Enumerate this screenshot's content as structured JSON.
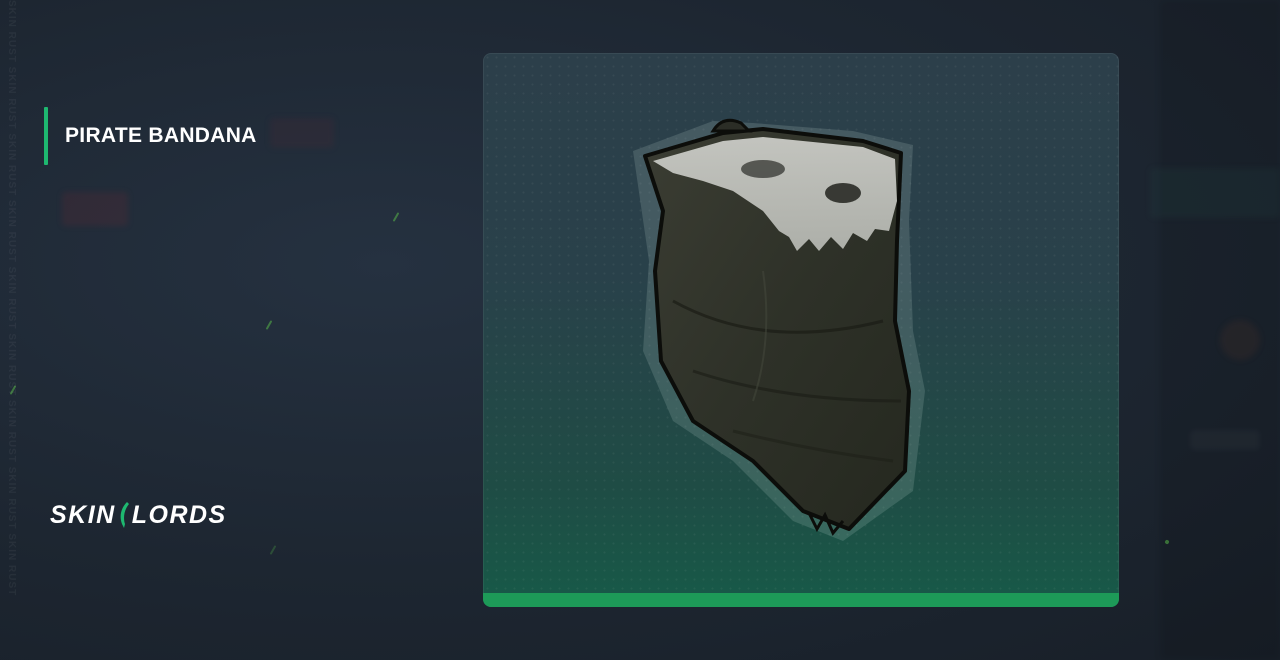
{
  "item": {
    "name": "PIRATE BANDANA",
    "image_icon": "pirate-bandana-icon"
  },
  "brand": {
    "logo_left": "SKIN",
    "logo_right": "LORDS",
    "watermark": "SKIN RUST SKIN RUST SKIN RUST SKIN RUST SKIN RUST SKIN RUST SKIN RUST SKIN RUST SKIN RUST"
  },
  "colors": {
    "background": "#1c2530",
    "accent": "#1eb870",
    "rarity_bar": "#1d9a58",
    "title_text": "#ffffff"
  }
}
